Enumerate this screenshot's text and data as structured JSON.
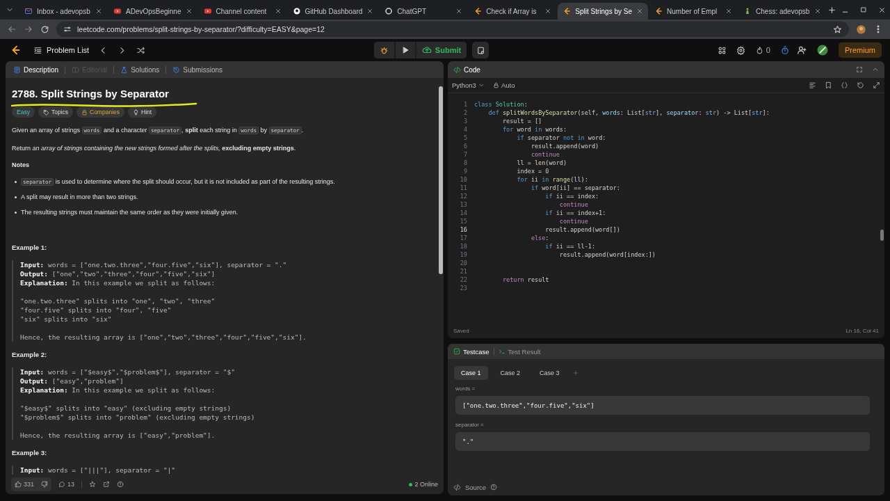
{
  "browser": {
    "tabs": [
      {
        "title": "Inbox - adevopsb",
        "kind": "mail",
        "selected": false
      },
      {
        "title": "ADevOpsBeginne",
        "kind": "video",
        "selected": false
      },
      {
        "title": "Channel content",
        "kind": "video",
        "selected": false
      },
      {
        "title": "GitHub Dashboard",
        "kind": "github",
        "selected": false
      },
      {
        "title": "ChatGPT",
        "kind": "chat",
        "selected": false
      },
      {
        "title": "Check if Array is",
        "kind": "leetcode",
        "selected": false
      },
      {
        "title": "Split Strings by Se",
        "kind": "leetcode",
        "selected": true
      },
      {
        "title": "Number of Empl",
        "kind": "leetcode",
        "selected": false
      },
      {
        "title": "Chess: adevopsb",
        "kind": "chess",
        "selected": false
      }
    ],
    "address": "leetcode.com/problems/split-strings-by-separator/?difficulty=EASY&page=12"
  },
  "nav": {
    "problem_list": "Problem List",
    "submit": "Submit",
    "streak": "0",
    "premium": "Premium"
  },
  "description": {
    "tabs": [
      {
        "label": "Description",
        "kind": "doc",
        "selected": true,
        "disabled": false
      },
      {
        "label": "Editorial",
        "kind": "book",
        "selected": false,
        "disabled": true
      },
      {
        "label": "Solutions",
        "kind": "flask",
        "selected": false,
        "disabled": false
      },
      {
        "label": "Submissions",
        "kind": "history",
        "selected": false,
        "disabled": false
      }
    ],
    "title": "2788. Split Strings by Separator",
    "tags": [
      {
        "label": "Easy",
        "kind": "difficulty"
      },
      {
        "label": "Topics",
        "kind": "topics"
      },
      {
        "label": "Companies",
        "kind": "companies"
      },
      {
        "label": "Hint",
        "kind": "hint"
      }
    ],
    "paragraphs": [
      [
        {
          "kind": "plain",
          "text": "Given an array of strings "
        },
        {
          "kind": "code",
          "text": "words"
        },
        {
          "kind": "plain",
          "text": " and a character "
        },
        {
          "kind": "code",
          "text": "separator"
        },
        {
          "kind": "plain",
          "text": ", **split** each string in "
        },
        {
          "kind": "code",
          "text": "words"
        },
        {
          "kind": "plain",
          "text": " by "
        },
        {
          "kind": "code",
          "text": "separator"
        },
        {
          "kind": "plain",
          "text": "."
        }
      ],
      [
        {
          "kind": "plain",
          "text": "Return *an array of strings containing the new strings formed after the splits,* **excluding empty strings**."
        }
      ]
    ],
    "notes_heading": "Notes",
    "notes": [
      [
        {
          "kind": "code",
          "text": "separator"
        },
        {
          "kind": "plain",
          "text": " is used to determine where the split should occur, but it is not included as part of the resulting strings."
        }
      ],
      [
        {
          "kind": "plain",
          "text": "A split may result in more than two strings."
        }
      ],
      [
        {
          "kind": "plain",
          "text": "The resulting strings must maintain the same order as they were initially given."
        }
      ]
    ],
    "examples": [
      {
        "heading": "Example 1:",
        "blocks": [
          [
            "**Input:** words = [\"one.two.three\",\"four.five\",\"six\"], separator = \".\"",
            "**Output:** [\"one\",\"two\",\"three\",\"four\",\"five\",\"six\"]",
            "**Explanation:** In this example we split as follows:"
          ],
          [
            "\"one.two.three\" splits into \"one\", \"two\", \"three\"",
            "\"four.five\" splits into \"four\", \"five\"",
            "\"six\" splits into \"six\""
          ],
          [
            "Hence, the resulting array is [\"one\",\"two\",\"three\",\"four\",\"five\",\"six\"]."
          ]
        ]
      },
      {
        "heading": "Example 2:",
        "blocks": [
          [
            "**Input:** words = [\"$easy$\",\"$problem$\"], separator = \"$\"",
            "**Output:** [\"easy\",\"problem\"]",
            "**Explanation:** In this example we split as follows:"
          ],
          [
            "\"$easy$\" splits into \"easy\" (excluding empty strings)",
            "\"$problem$\" splits into \"problem\" (excluding empty strings)"
          ],
          [
            "Hence, the resulting array is [\"easy\",\"problem\"]."
          ]
        ]
      },
      {
        "heading": "Example 3:",
        "blocks": [
          [
            "**Input:** words = [\"|||\"], separator = \"|\""
          ]
        ]
      }
    ],
    "footer": {
      "likes": "331",
      "comments": "13",
      "online": "2 Online"
    }
  },
  "editor": {
    "title": "Code",
    "language": "Python3",
    "mode": "Auto",
    "lines": [
      {
        "number": "1",
        "current": false,
        "tokens": [
          {
            "kind": "keyword",
            "text": "class "
          },
          {
            "kind": "class",
            "text": "Solution"
          },
          {
            "kind": "plain",
            "text": ":"
          }
        ]
      },
      {
        "number": "2",
        "current": false,
        "tokens": [
          {
            "kind": "keyword",
            "text": "    def "
          },
          {
            "kind": "function",
            "text": "splitWordsBySeparator"
          },
          {
            "kind": "plain",
            "text": "(self, "
          },
          {
            "kind": "variable",
            "text": "words"
          },
          {
            "kind": "plain",
            "text": ": List["
          },
          {
            "kind": "type",
            "text": "str"
          },
          {
            "kind": "plain",
            "text": "], "
          },
          {
            "kind": "variable",
            "text": "separator"
          },
          {
            "kind": "plain",
            "text": ": "
          },
          {
            "kind": "type",
            "text": "str"
          },
          {
            "kind": "plain",
            "text": ") -> List["
          },
          {
            "kind": "type",
            "text": "str"
          },
          {
            "kind": "plain",
            "text": "]:"
          }
        ]
      },
      {
        "number": "3",
        "current": false,
        "tokens": [
          {
            "kind": "plain",
            "text": "        result = []"
          }
        ]
      },
      {
        "number": "4",
        "current": false,
        "tokens": [
          {
            "kind": "keyword",
            "text": "        for"
          },
          {
            "kind": "plain",
            "text": " word "
          },
          {
            "kind": "keyword",
            "text": "in"
          },
          {
            "kind": "plain",
            "text": " words:"
          }
        ]
      },
      {
        "number": "5",
        "current": false,
        "tokens": [
          {
            "kind": "keyword",
            "text": "            if"
          },
          {
            "kind": "plain",
            "text": " separator "
          },
          {
            "kind": "keyword",
            "text": "not in"
          },
          {
            "kind": "plain",
            "text": " word:"
          }
        ]
      },
      {
        "number": "6",
        "current": false,
        "tokens": [
          {
            "kind": "plain",
            "text": "                result.append(word)"
          }
        ]
      },
      {
        "number": "7",
        "current": false,
        "tokens": [
          {
            "kind": "control",
            "text": "                continue"
          }
        ]
      },
      {
        "number": "8",
        "current": false,
        "tokens": [
          {
            "kind": "plain",
            "text": "            ll = "
          },
          {
            "kind": "function",
            "text": "len"
          },
          {
            "kind": "plain",
            "text": "(word)"
          }
        ]
      },
      {
        "number": "9",
        "current": false,
        "tokens": [
          {
            "kind": "plain",
            "text": "            index = "
          },
          {
            "kind": "number",
            "text": "0"
          }
        ]
      },
      {
        "number": "10",
        "current": false,
        "tokens": [
          {
            "kind": "keyword",
            "text": "            for"
          },
          {
            "kind": "plain",
            "text": " ii "
          },
          {
            "kind": "keyword",
            "text": "in "
          },
          {
            "kind": "function",
            "text": "range"
          },
          {
            "kind": "plain",
            "text": "(ll):"
          }
        ]
      },
      {
        "number": "11",
        "current": false,
        "tokens": [
          {
            "kind": "keyword",
            "text": "                if"
          },
          {
            "kind": "plain",
            "text": " word[ii] == separator:"
          }
        ]
      },
      {
        "number": "12",
        "current": false,
        "tokens": [
          {
            "kind": "keyword",
            "text": "                    if"
          },
          {
            "kind": "plain",
            "text": " ii == index:"
          }
        ]
      },
      {
        "number": "13",
        "current": false,
        "tokens": [
          {
            "kind": "control",
            "text": "                        continue"
          }
        ]
      },
      {
        "number": "14",
        "current": false,
        "tokens": [
          {
            "kind": "keyword",
            "text": "                    if"
          },
          {
            "kind": "plain",
            "text": " ii == index+1:"
          }
        ]
      },
      {
        "number": "15",
        "current": false,
        "tokens": [
          {
            "kind": "control",
            "text": "                        continue"
          }
        ]
      },
      {
        "number": "16",
        "current": true,
        "tokens": [
          {
            "kind": "plain",
            "text": "                    result.append(word[])"
          }
        ]
      },
      {
        "number": "17",
        "current": false,
        "tokens": [
          {
            "kind": "control",
            "text": "                else"
          },
          {
            "kind": "plain",
            "text": ":"
          }
        ]
      },
      {
        "number": "18",
        "current": false,
        "tokens": [
          {
            "kind": "keyword",
            "text": "                    if"
          },
          {
            "kind": "plain",
            "text": " ii == ll-1:"
          }
        ]
      },
      {
        "number": "19",
        "current": false,
        "tokens": [
          {
            "kind": "plain",
            "text": "                        result.append(word[index:])"
          }
        ]
      },
      {
        "number": "20",
        "current": false
      },
      {
        "number": "21",
        "current": false
      },
      {
        "number": "22",
        "current": false,
        "tokens": [
          {
            "kind": "control",
            "text": "        return"
          },
          {
            "kind": "plain",
            "text": " result"
          }
        ]
      },
      {
        "number": "23",
        "current": false
      }
    ],
    "status": "Saved",
    "position": "Ln 16, Col 41"
  },
  "testcase": {
    "tabs": [
      {
        "label": "Testcase",
        "kind": "check",
        "selected": true
      },
      {
        "label": "Test Result",
        "kind": "terminal",
        "selected": false
      }
    ],
    "cases": [
      {
        "label": "Case 1",
        "selected": true
      },
      {
        "label": "Case 2",
        "selected": false
      },
      {
        "label": "Case 3",
        "selected": false
      }
    ],
    "params": [
      {
        "name": "words =",
        "value": "[\"one.two.three\",\"four.five\",\"six\"]"
      },
      {
        "name": "separator =",
        "value": "\".\""
      }
    ],
    "source": "Source"
  }
}
